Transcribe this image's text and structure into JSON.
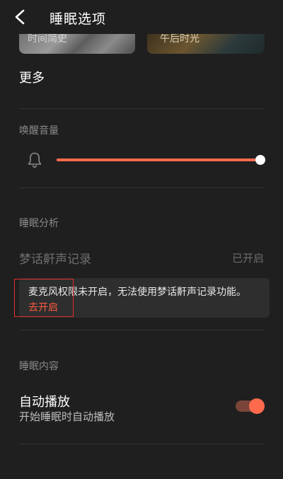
{
  "header": {
    "title": "睡眠选项"
  },
  "thumbnails": [
    {
      "label": "时间简史"
    },
    {
      "label": "午后时光"
    }
  ],
  "more": {
    "label": "更多"
  },
  "wake_volume": {
    "title": "唤醒音量",
    "level_percent": 100,
    "accent_color": "#ff6a4d"
  },
  "sleep_analysis": {
    "title": "睡眠分析",
    "dream_talk_label": "梦话鼾声记录",
    "dream_talk_status": "已开启",
    "mic_warning": "麦克风权限未开启，无法使用梦话鼾声记录功能。",
    "mic_action": "去开启"
  },
  "sleep_content": {
    "title": "睡眠内容",
    "autoplay_title": "自动播放",
    "autoplay_desc": "开始睡眠时自动播放",
    "autoplay_on": true
  }
}
